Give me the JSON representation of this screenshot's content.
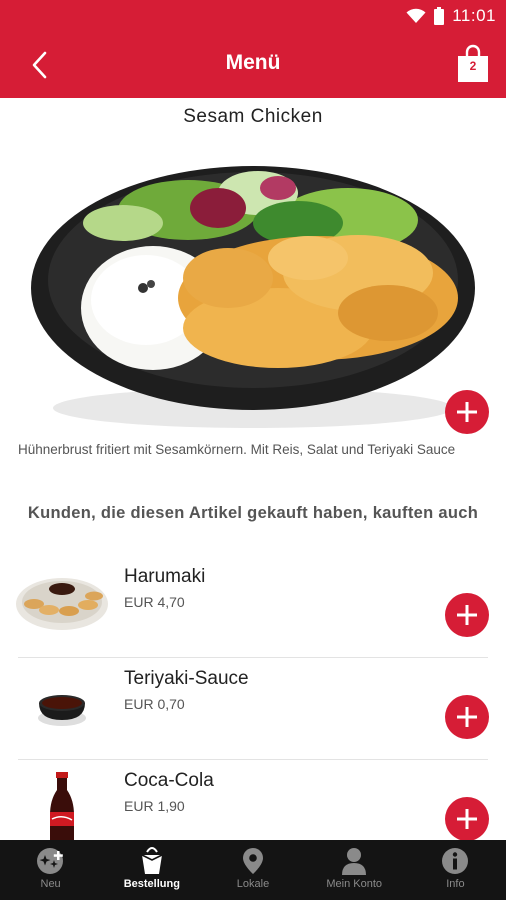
{
  "status_bar": {
    "time": "11:01"
  },
  "header": {
    "title": "Menü",
    "cart_count": "2"
  },
  "product": {
    "title": "Sesam Chicken",
    "description": "Hühnerbrust fritiert mit Sesamkörnern. Mit Reis, Salat und Teriyaki Sauce"
  },
  "cross_sell": {
    "heading": "Kunden, die diesen Artikel gekauft haben, kauften auch",
    "items": [
      {
        "name": "Harumaki",
        "price": "EUR 4,70"
      },
      {
        "name": "Teriyaki-Sauce",
        "price": "EUR 0,70"
      },
      {
        "name": "Coca-Cola",
        "price": "EUR 1,90"
      }
    ]
  },
  "bottom_nav": {
    "items": [
      {
        "label": "Neu",
        "icon": "new-star-icon"
      },
      {
        "label": "Bestellung",
        "icon": "takeaway-box-icon"
      },
      {
        "label": "Lokale",
        "icon": "location-pin-icon"
      },
      {
        "label": "Mein Konto",
        "icon": "person-icon"
      },
      {
        "label": "Info",
        "icon": "info-icon"
      }
    ],
    "active_index": 1
  },
  "colors": {
    "primary": "#d61d36",
    "nav_background": "#141414"
  }
}
